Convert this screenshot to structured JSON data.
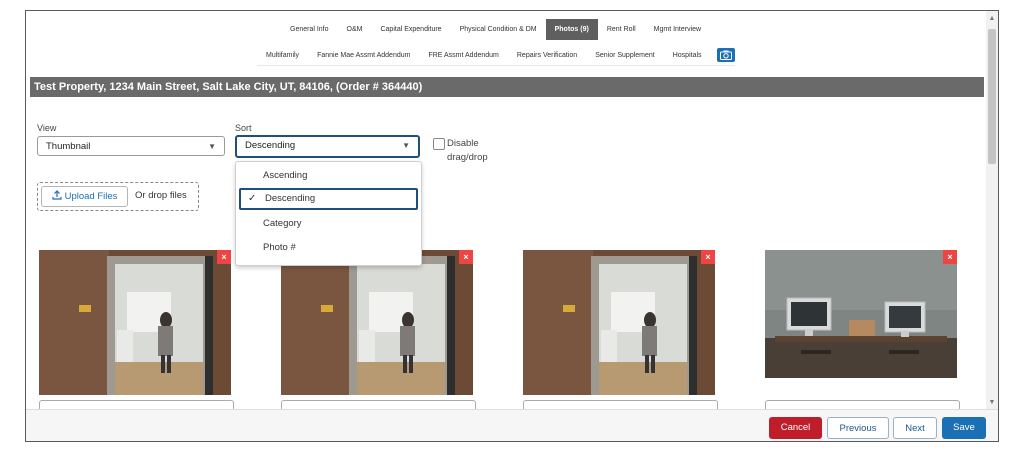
{
  "nav": {
    "row1": [
      "General Info",
      "O&M",
      "Capital Expenditure",
      "Physical Condition & DM",
      "Photos (9)",
      "Rent Roll",
      "Mgmt Interview"
    ],
    "row2": [
      "Multifamily",
      "Fannie Mae Assmt Addendum",
      "FRE Assmt Addendum",
      "Repairs Verification",
      "Senior Supplement",
      "Hospitals"
    ]
  },
  "property_title": "Test Property, 1234 Main Street, Salt Lake City, UT, 84106, (Order # 364440)",
  "view": {
    "label": "View",
    "value": "Thumbnail"
  },
  "sort": {
    "label": "Sort",
    "value": "Descending",
    "options": [
      "Ascending",
      "Descending",
      "Category",
      "Photo #"
    ],
    "selected_index": 1
  },
  "disable_drag": {
    "label": "Disable drag/drop"
  },
  "upload": {
    "button_label": "Upload Files",
    "drop_text": "Or drop files"
  },
  "photos": [
    {
      "icon": "door-photo",
      "remove": "×"
    },
    {
      "icon": "door-photo",
      "remove": "×"
    },
    {
      "icon": "door-photo",
      "remove": "×"
    },
    {
      "icon": "office-desk-photo",
      "remove": "×"
    }
  ],
  "footer": {
    "cancel": "Cancel",
    "previous": "Previous",
    "next": "Next",
    "save": "Save"
  },
  "colors": {
    "active_tab": "#5f5f5f",
    "primary": "#1b6fb5",
    "danger": "#c01d2b",
    "title_bar": "#6a6a6a"
  }
}
